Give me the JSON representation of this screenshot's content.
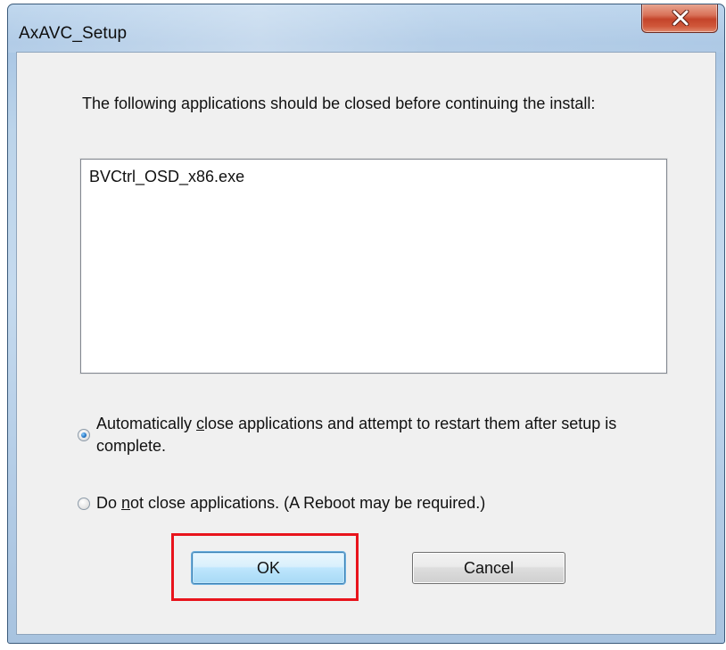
{
  "window": {
    "title": "AxAVC_Setup"
  },
  "message": "The following applications should be closed before continuing the install:",
  "applications": [
    "BVCtrl_OSD_x86.exe"
  ],
  "options": [
    {
      "pre": "Automatically ",
      "accel": "c",
      "post": "lose applications and attempt to restart them after setup is complete.",
      "checked": true
    },
    {
      "pre": "Do ",
      "accel": "n",
      "post": "ot close applications. (A Reboot may be required.)",
      "checked": false
    }
  ],
  "buttons": {
    "ok_label": "OK",
    "cancel_label": "Cancel"
  },
  "icons": {
    "close": "close-icon"
  },
  "colors": {
    "highlight": "#e8141c",
    "close_button": "#c4442a",
    "default_button_border": "#3c7fb1"
  }
}
